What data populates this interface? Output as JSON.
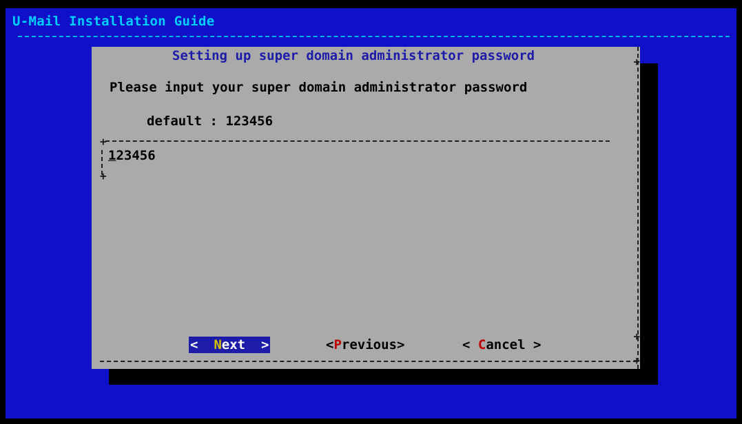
{
  "backtitle": "U-Mail Installation Guide",
  "dialog": {
    "title": "Setting up super domain administrator password",
    "prompt": "Please input your super domain administrator password",
    "default_text": "default : 123456",
    "input": {
      "value_first": "1",
      "value_rest": "23456"
    },
    "buttons": {
      "next": {
        "open": "<  ",
        "hot": "N",
        "rest": "ext",
        "close": "  >"
      },
      "previous": {
        "open": "<",
        "hot": "P",
        "rest": "revious",
        "close": ">"
      },
      "cancel": {
        "open": "< ",
        "hot": "C",
        "rest": "ancel",
        "close": " >"
      }
    }
  },
  "colors": {
    "background": "#1010c8",
    "dialog": "#aaaaaa",
    "title_text": "#1c1ca8",
    "backtitle_text": "#00d0ff",
    "hotkey": "#c00000",
    "selected_button_bg": "#1c1ca8"
  }
}
